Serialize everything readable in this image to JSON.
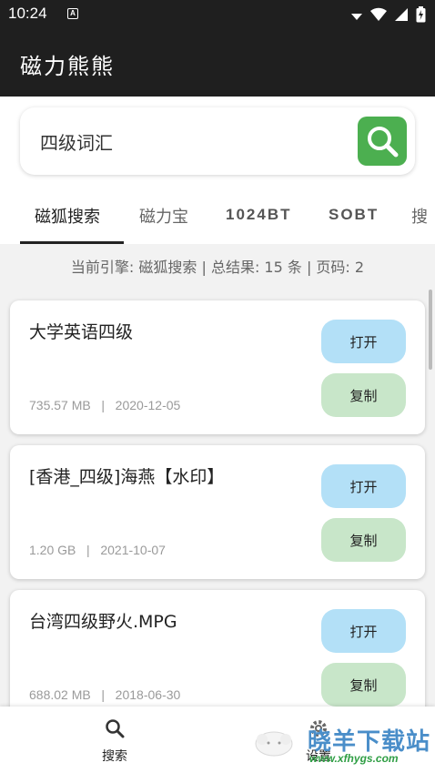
{
  "status_bar": {
    "time": "10:24",
    "notification_letter": "A"
  },
  "app_bar": {
    "title": "磁力熊熊"
  },
  "search": {
    "value": "四级词汇",
    "button_icon": "search-icon"
  },
  "tabs": [
    {
      "label": "磁狐搜索",
      "active": true
    },
    {
      "label": "磁力宝",
      "active": false
    },
    {
      "label": "1024BT",
      "active": false
    },
    {
      "label": "SOBT",
      "active": false
    },
    {
      "label": "搜",
      "active": false
    }
  ],
  "info_line": "当前引擎: 磁狐搜索 | 总结果: 15 条 | 页码: 2",
  "results": [
    {
      "title": "大学英语四级",
      "meta": "735.57 MB   |   2020-12-05",
      "open_label": "打开",
      "copy_label": "复制"
    },
    {
      "title": "[香港_四级]海燕【水印】",
      "meta": "1.20 GB   |   2021-10-07",
      "open_label": "打开",
      "copy_label": "复制"
    },
    {
      "title": "台湾四级野火.MPG",
      "meta": "688.02 MB   |   2018-06-30",
      "open_label": "打开",
      "copy_label": "复制"
    }
  ],
  "bottom_nav": [
    {
      "label": "搜索",
      "icon": "search-icon"
    },
    {
      "label": "设置",
      "icon": "gear-icon"
    }
  ],
  "watermark": {
    "title": "晓羊下载站",
    "url": "www.xfhygs.com"
  },
  "colors": {
    "app_bar": "#1f1f1f",
    "search_button": "#4caf50",
    "open_button": "#b3e0f7",
    "copy_button": "#c8e6c9",
    "watermark_title": "#4a8ec9",
    "watermark_url": "#2f9e44"
  }
}
